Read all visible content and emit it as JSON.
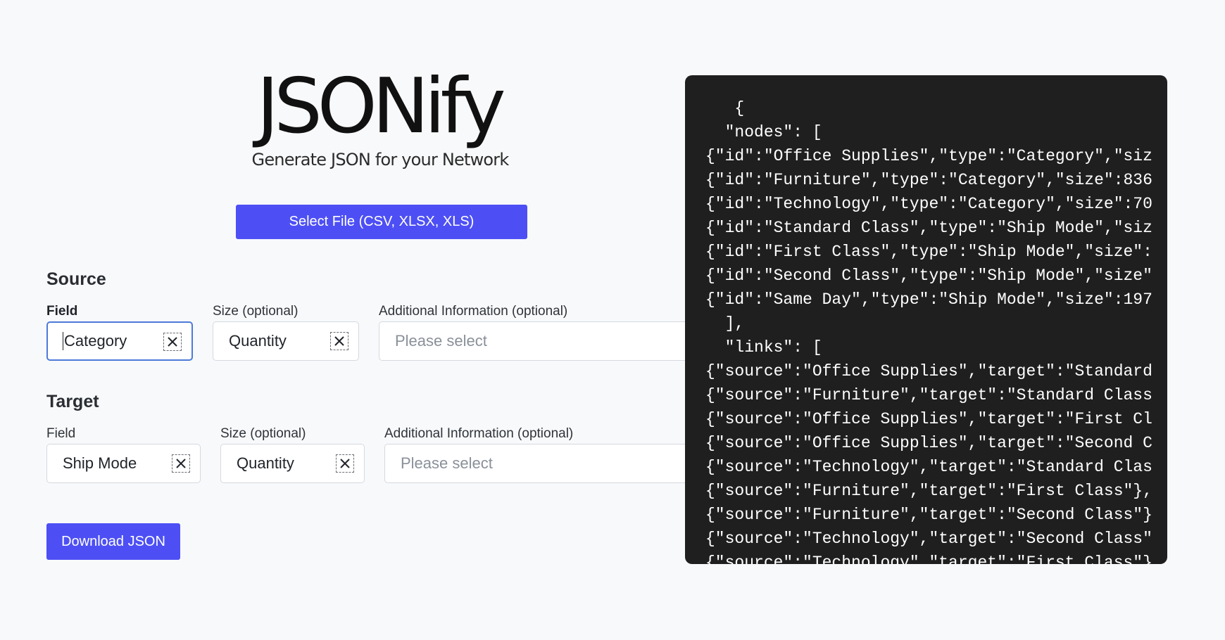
{
  "logo": {
    "title": "JSONify",
    "tagline": "Generate JSON for your Network"
  },
  "select_file_button": "Select File (CSV, XLSX, XLS)",
  "source": {
    "title": "Source",
    "field_label": "Field",
    "field_value": "Category",
    "size_label": "Size (optional)",
    "size_value": "Quantity",
    "info_label": "Additional Information (optional)",
    "info_placeholder": "Please select"
  },
  "target": {
    "title": "Target",
    "field_label": "Field",
    "field_value": "Ship Mode",
    "size_label": "Size (optional)",
    "size_value": "Quantity",
    "info_label": "Additional Information (optional)",
    "info_placeholder": "Please select"
  },
  "download_button": "Download JSON",
  "icons": {
    "clear": "close-icon"
  },
  "colors": {
    "accent": "#4d4ff5",
    "panel_bg": "#1f1f1f",
    "focus_border": "#4d7ad9"
  },
  "json_preview": {
    "lines": [
      "   {",
      "  \"nodes\": [",
      "{\"id\":\"Office Supplies\",\"type\":\"Category\",\"siz",
      "{\"id\":\"Furniture\",\"type\":\"Category\",\"size\":836",
      "{\"id\":\"Technology\",\"type\":\"Category\",\"size\":70",
      "{\"id\":\"Standard Class\",\"type\":\"Ship Mode\",\"siz",
      "{\"id\":\"First Class\",\"type\":\"Ship Mode\",\"size\":",
      "{\"id\":\"Second Class\",\"type\":\"Ship Mode\",\"size\"",
      "{\"id\":\"Same Day\",\"type\":\"Ship Mode\",\"size\":197",
      "  ],",
      "  \"links\": [",
      "{\"source\":\"Office Supplies\",\"target\":\"Standard",
      "{\"source\":\"Furniture\",\"target\":\"Standard Class",
      "{\"source\":\"Office Supplies\",\"target\":\"First Cl",
      "{\"source\":\"Office Supplies\",\"target\":\"Second C",
      "{\"source\":\"Technology\",\"target\":\"Standard Clas",
      "{\"source\":\"Furniture\",\"target\":\"First Class\"},",
      "{\"source\":\"Furniture\",\"target\":\"Second Class\"}",
      "{\"source\":\"Technology\",\"target\":\"Second Class\"",
      "{\"source\":\"Technology\",\"target\":\"First Class\"}"
    ]
  }
}
